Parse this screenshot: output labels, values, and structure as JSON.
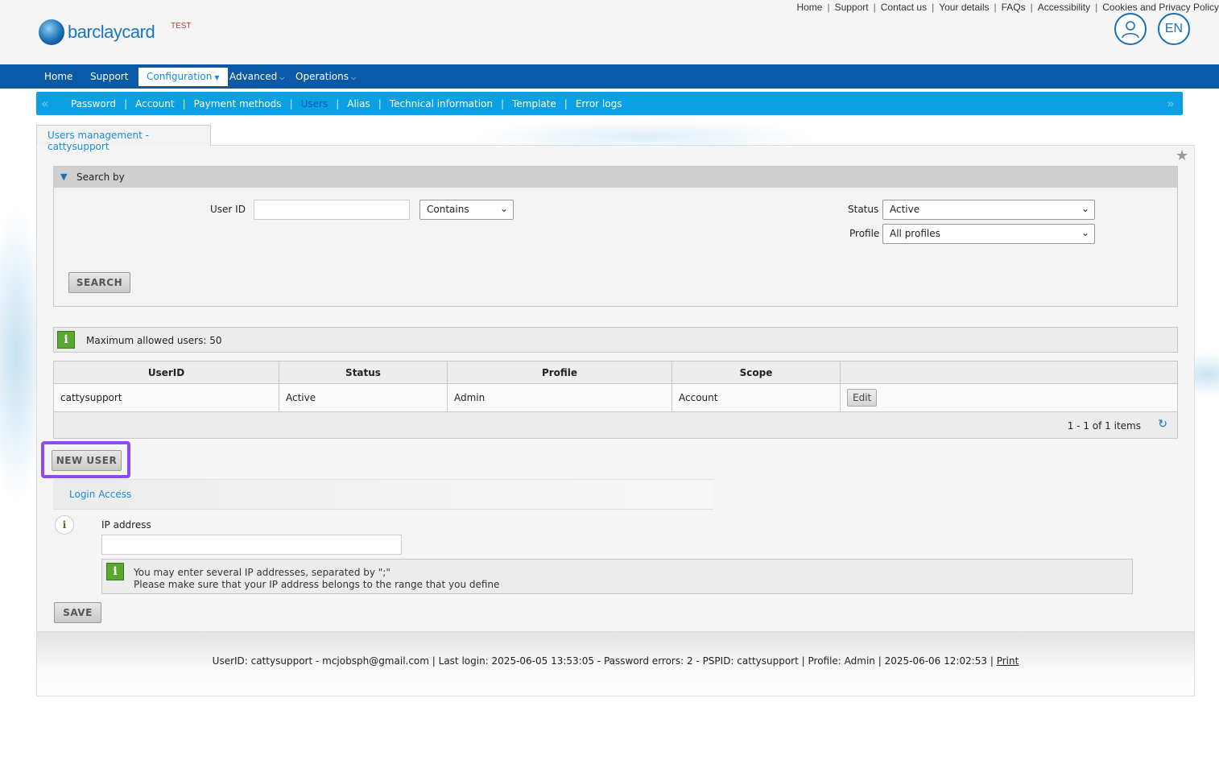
{
  "header": {
    "brand": "barclaycard",
    "env_badge": "TEST",
    "top_links": [
      "Home",
      "Support",
      "Contact us",
      "Your details",
      "FAQs",
      "Accessibility",
      "Cookies and Privacy Policy"
    ],
    "lang": "EN"
  },
  "main_nav": {
    "home": "Home",
    "support": "Support",
    "configuration": "Configuration",
    "advanced": "Advanced",
    "operations": "Operations"
  },
  "sub_nav": {
    "password": "Password",
    "account": "Account",
    "payment_methods": "Payment methods",
    "users": "Users",
    "alias": "Alias",
    "technical_information": "Technical information",
    "template": "Template",
    "error_logs": "Error logs"
  },
  "tab": {
    "title": "Users management - cattysupport"
  },
  "search": {
    "header": "Search by",
    "user_id_label": "User ID",
    "user_id_value": "",
    "match_mode": "Contains",
    "status_label": "Status",
    "status_value": "Active",
    "profile_label": "Profile",
    "profile_value": "All profiles",
    "search_button": "SEARCH"
  },
  "limit_info": "Maximum allowed users: 50",
  "users_table": {
    "headers": [
      "UserID",
      "Status",
      "Profile",
      "Scope",
      ""
    ],
    "rows": [
      {
        "userid": "cattysupport",
        "status": "Active",
        "profile": "Admin",
        "scope": "Account",
        "action": "Edit"
      }
    ],
    "pagination": "1 - 1 of 1 items"
  },
  "new_user_button": "NEW USER",
  "login_access": {
    "title": "Login Access",
    "ip_label": "IP address",
    "ip_value": "",
    "hint_line1": "You may enter several IP addresses, separated by \";\"",
    "hint_line2": "Please make sure that your IP address belongs to the range that you define",
    "save_button": "SAVE"
  },
  "footer": {
    "info": "UserID: cattysupport - mcjobsph@gmail.com | Last login: 2025-06-05 13:53:05 - Password errors: 2 - PSPID: cattysupport | Profile: Admin | 2025-06-06 12:02:53 |",
    "print_link": "Print"
  },
  "colors": {
    "main_nav_bg": "#0a5aa8",
    "sub_nav_bg": "#0aa0e3",
    "highlight": "#8b4cf0",
    "info_green": "#5aa832"
  }
}
